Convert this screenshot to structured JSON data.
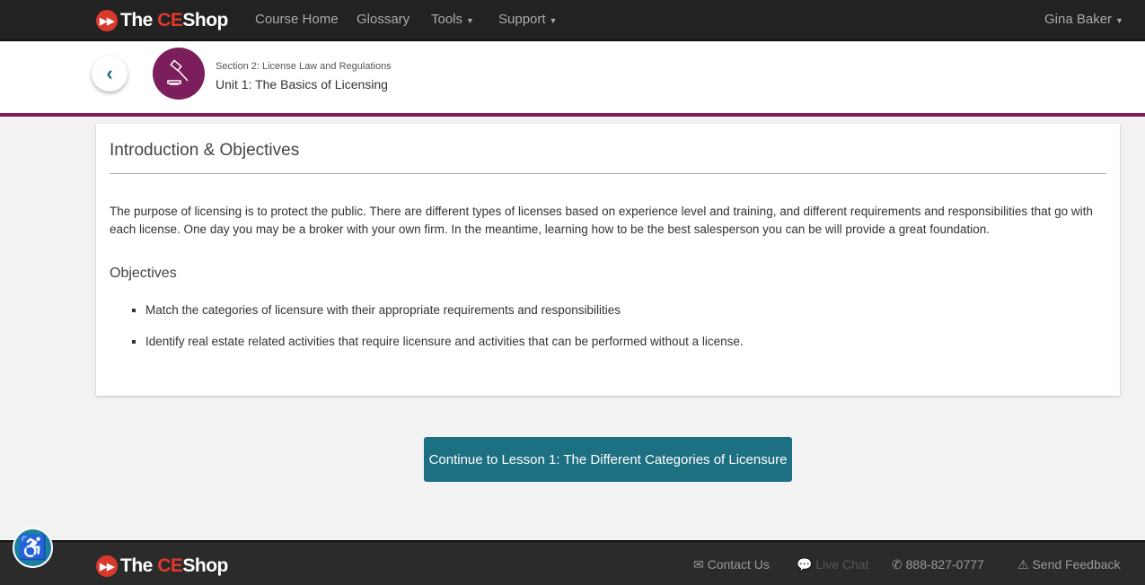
{
  "brand": {
    "the": "The",
    "ce": "CE",
    "shop": "Shop"
  },
  "nav": {
    "course_home": "Course Home",
    "glossary": "Glossary",
    "tools": "Tools",
    "support": "Support",
    "user": "Gina Baker"
  },
  "header": {
    "section": "Section 2: License Law and Regulations",
    "unit": "Unit 1: The Basics of Licensing"
  },
  "card": {
    "title": "Introduction & Objectives",
    "body": "The purpose of licensing is to protect the public. There are different types of licenses based on experience level and training, and different requirements and responsibilities that go with each license. One day you may be a broker with your own firm. In the meantime, learning how to be the best salesperson you can be will provide a great foundation.",
    "objectives_title": "Objectives",
    "objectives": [
      "Match the categories of licensure with their appropriate requirements and responsibilities",
      "Identify real estate related activities that require licensure and activities that can be performed without a license."
    ]
  },
  "cta": "Continue to Lesson 1: The Different Categories of Licensure",
  "footer": {
    "contact": "Contact Us",
    "chat": "Live Chat",
    "phone": "888-827-0777",
    "feedback": "Send Feedback"
  },
  "colors": {
    "accent": "#1d6f82",
    "brand_purple": "#7b1e5b",
    "logo_red": "#e0392b"
  }
}
